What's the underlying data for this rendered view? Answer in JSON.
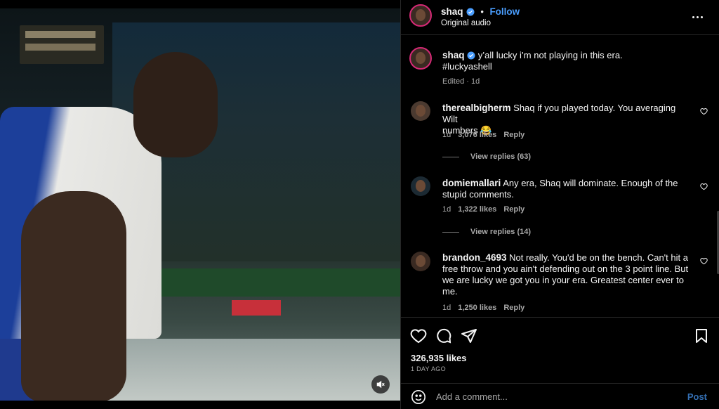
{
  "post": {
    "author": "shaq",
    "follow_label": "Follow",
    "audio": "Original audio",
    "caption": "y'all lucky i'm not playing in this era. #luckyashell",
    "caption_line1": "y’all lucky i’m not playing in this era.",
    "caption_line2": "#luckyashell",
    "caption_meta": "Edited · 1d",
    "likes": "326,935 likes",
    "time_ago": "1 DAY AGO"
  },
  "comments": [
    {
      "user": "therealbigherm",
      "text_line1": "Shaq if you played today. You averaging Wilt",
      "text_line2": "numbers 😂",
      "age": "1d",
      "likes": "3,076 likes",
      "reply": "Reply",
      "view_replies": "View replies (63)"
    },
    {
      "user": "domiemallari",
      "text_line1": "Any era, Shaq will dominate. Enough of the",
      "text_line2": "stupid comments.",
      "age": "1d",
      "likes": "1,322 likes",
      "reply": "Reply",
      "view_replies": "View replies (14)"
    },
    {
      "user": "brandon_4693",
      "text_line1": "Not really. You'd be on the bench. Can't hit a",
      "text_line2": "free throw and you ain't defending out on the 3 point line. But",
      "text_line3": "we are lucky we got you in your era. Greatest center ever to",
      "text_line4": "me.",
      "age": "1d",
      "likes": "1,250 likes",
      "reply": "Reply"
    }
  ],
  "add_comment": {
    "placeholder": "Add a comment...",
    "post_label": "Post"
  },
  "icons": {
    "verified": "verified-badge-icon",
    "more": "more-options-icon",
    "like": "heart-icon",
    "comment": "comment-icon",
    "share": "share-icon",
    "save": "bookmark-icon",
    "emoji": "emoji-icon",
    "mute": "muted-speaker-icon"
  },
  "colors": {
    "accent": "#4a9eff",
    "background": "#000000",
    "muted_text": "#a8a8a8"
  }
}
